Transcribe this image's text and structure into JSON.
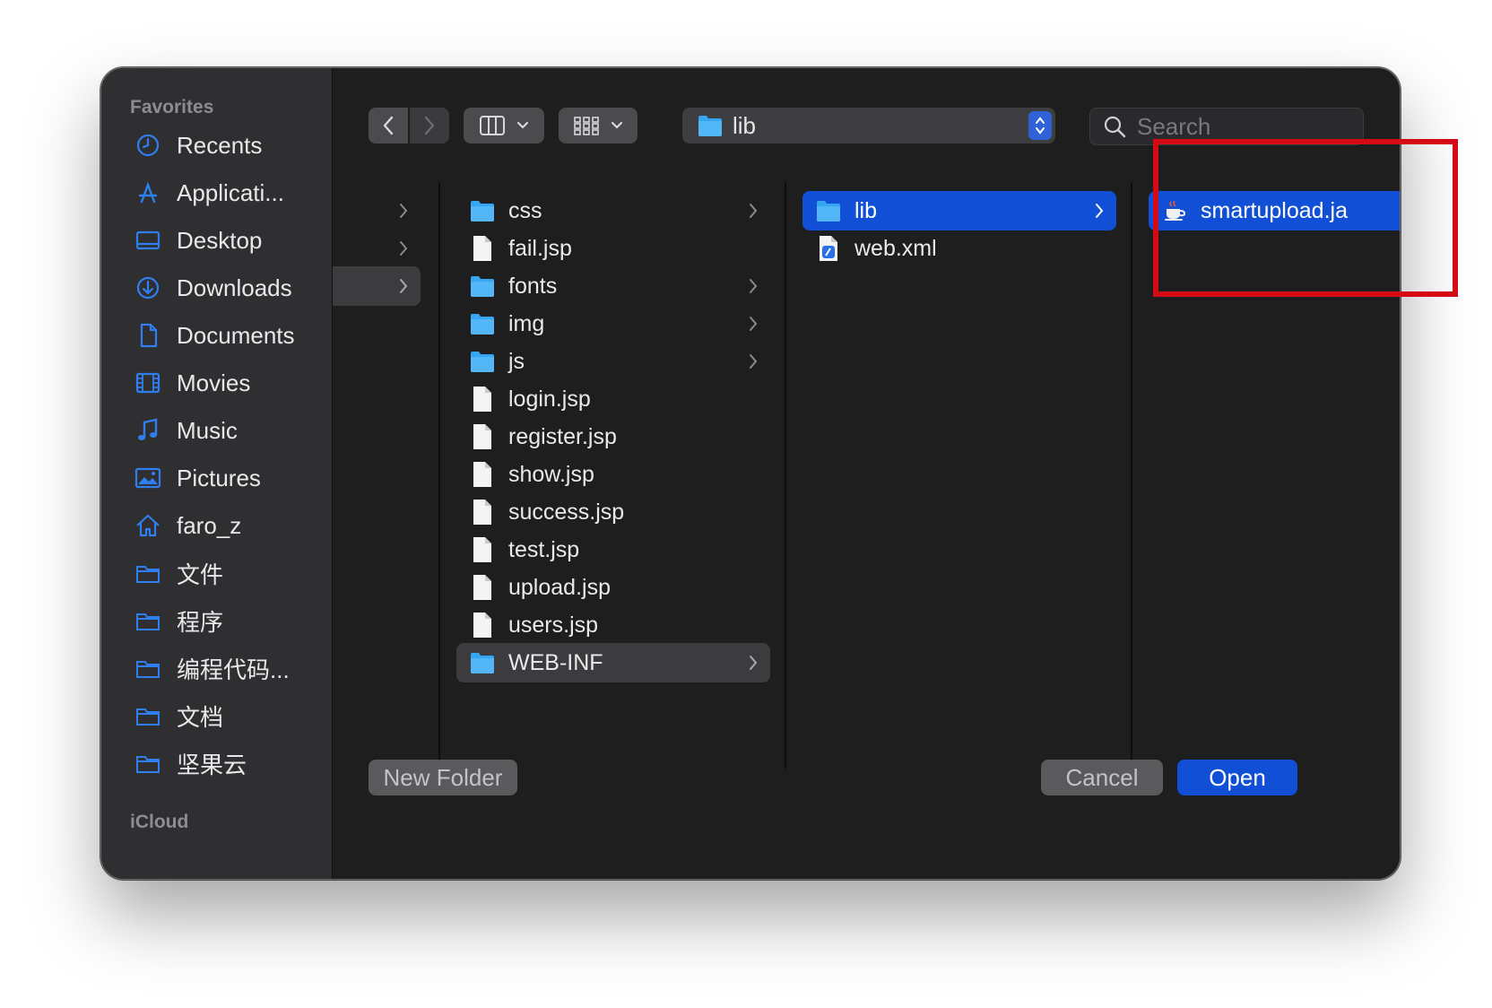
{
  "sidebar": {
    "favorites_heading": "Favorites",
    "icloud_heading": "iCloud",
    "items": [
      {
        "label": "Recents",
        "icon": "clock-icon"
      },
      {
        "label": "Applicati...",
        "icon": "applications-icon"
      },
      {
        "label": "Desktop",
        "icon": "desktop-icon"
      },
      {
        "label": "Downloads",
        "icon": "downloads-icon"
      },
      {
        "label": "Documents",
        "icon": "document-icon"
      },
      {
        "label": "Movies",
        "icon": "film-icon"
      },
      {
        "label": "Music",
        "icon": "music-note-icon"
      },
      {
        "label": "Pictures",
        "icon": "photo-icon"
      },
      {
        "label": "faro_z",
        "icon": "home-icon"
      },
      {
        "label": "文件",
        "icon": "folder-icon"
      },
      {
        "label": "程序",
        "icon": "folder-icon"
      },
      {
        "label": "编程代码...",
        "icon": "folder-icon"
      },
      {
        "label": "文档",
        "icon": "folder-icon"
      },
      {
        "label": "坚果云",
        "icon": "folder-icon"
      }
    ]
  },
  "toolbar": {
    "path_label": "lib",
    "search_placeholder": "Search"
  },
  "columns": {
    "col2": [
      {
        "label": "css",
        "type": "folder",
        "chevron": true
      },
      {
        "label": "fail.jsp",
        "type": "file"
      },
      {
        "label": "fonts",
        "type": "folder",
        "chevron": true
      },
      {
        "label": "img",
        "type": "folder",
        "chevron": true
      },
      {
        "label": "js",
        "type": "folder",
        "chevron": true
      },
      {
        "label": "login.jsp",
        "type": "file"
      },
      {
        "label": "register.jsp",
        "type": "file"
      },
      {
        "label": "show.jsp",
        "type": "file"
      },
      {
        "label": "success.jsp",
        "type": "file"
      },
      {
        "label": "test.jsp",
        "type": "file"
      },
      {
        "label": "upload.jsp",
        "type": "file"
      },
      {
        "label": "users.jsp",
        "type": "file"
      },
      {
        "label": "WEB-INF",
        "type": "folder",
        "chevron": true,
        "highlighted": true
      }
    ],
    "col3": [
      {
        "label": "lib",
        "type": "folder",
        "chevron": true,
        "selected": true
      },
      {
        "label": "web.xml",
        "type": "xml"
      }
    ],
    "col4": [
      {
        "label": "smartupload.ja",
        "type": "jar",
        "selected": true
      }
    ]
  },
  "buttons": {
    "new_folder": "New Folder",
    "cancel": "Cancel",
    "open": "Open"
  },
  "colors": {
    "accent": "#1150d6",
    "annotation": "#d40a17",
    "folder": "#36a6f2"
  }
}
